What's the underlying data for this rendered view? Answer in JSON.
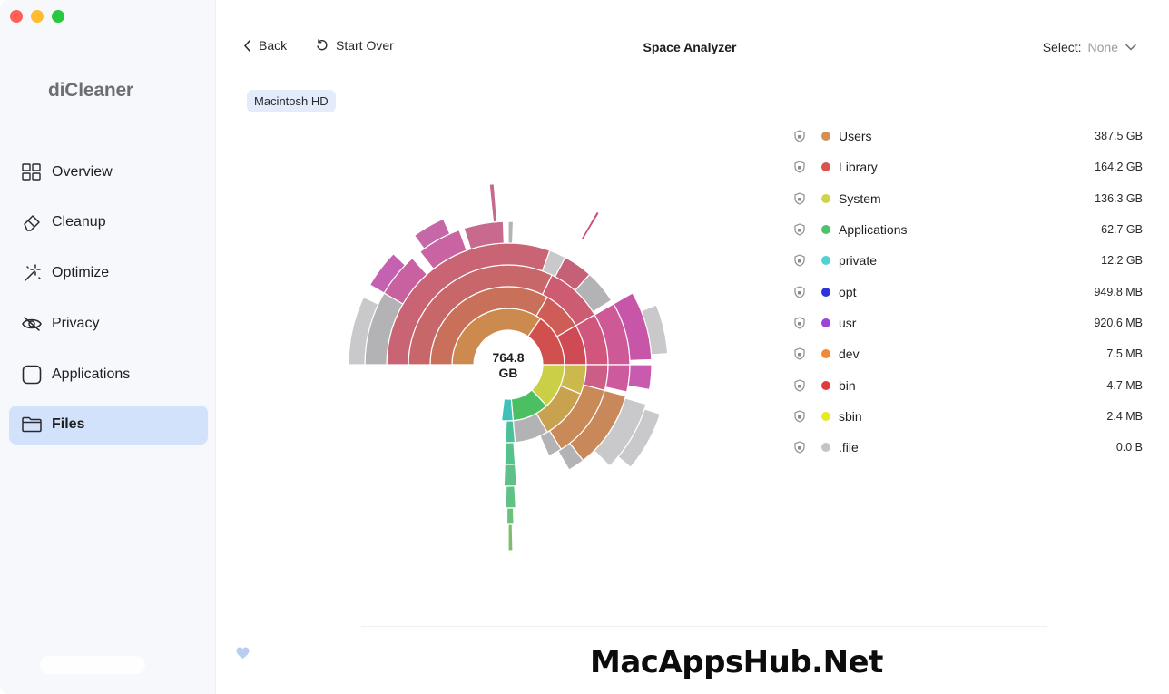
{
  "sidebar": {
    "app_name": "diCleaner",
    "items": [
      {
        "label": "Overview",
        "icon": "grid-icon"
      },
      {
        "label": "Cleanup",
        "icon": "eraser-icon"
      },
      {
        "label": "Optimize",
        "icon": "magic-wand-icon"
      },
      {
        "label": "Privacy",
        "icon": "eye-slash-icon"
      },
      {
        "label": "Applications",
        "icon": "app-square-icon"
      },
      {
        "label": "Files",
        "icon": "folder-icon",
        "active": true
      }
    ]
  },
  "toolbar": {
    "back_label": "Back",
    "start_over_label": "Start Over",
    "title": "Space Analyzer",
    "select_label": "Select:",
    "select_value": "None"
  },
  "breadcrumb": {
    "volume": "Macintosh HD"
  },
  "chart_center": {
    "value": "764.8",
    "unit": "GB"
  },
  "legend": [
    {
      "name": "Users",
      "size": "387.5 GB",
      "color": "#d48f52"
    },
    {
      "name": "Library",
      "size": "164.2 GB",
      "color": "#d9534f"
    },
    {
      "name": "System",
      "size": "136.3 GB",
      "color": "#cfd44a"
    },
    {
      "name": "Applications",
      "size": "62.7 GB",
      "color": "#4ec26a"
    },
    {
      "name": "private",
      "size": "12.2 GB",
      "color": "#4fd2d2"
    },
    {
      "name": "opt",
      "size": "949.8 MB",
      "color": "#2b35d9"
    },
    {
      "name": "usr",
      "size": "920.6 MB",
      "color": "#9b44d8"
    },
    {
      "name": "dev",
      "size": "7.5 MB",
      "color": "#ef8a3a"
    },
    {
      "name": "bin",
      "size": "4.7 MB",
      "color": "#e23a3a"
    },
    {
      "name": "sbin",
      "size": "2.4 MB",
      "color": "#e6ea22"
    },
    {
      "name": ".file",
      "size": "0.0 B",
      "color": "#c4c4c6"
    }
  ],
  "watermark": "MacAppsHub.Net"
}
